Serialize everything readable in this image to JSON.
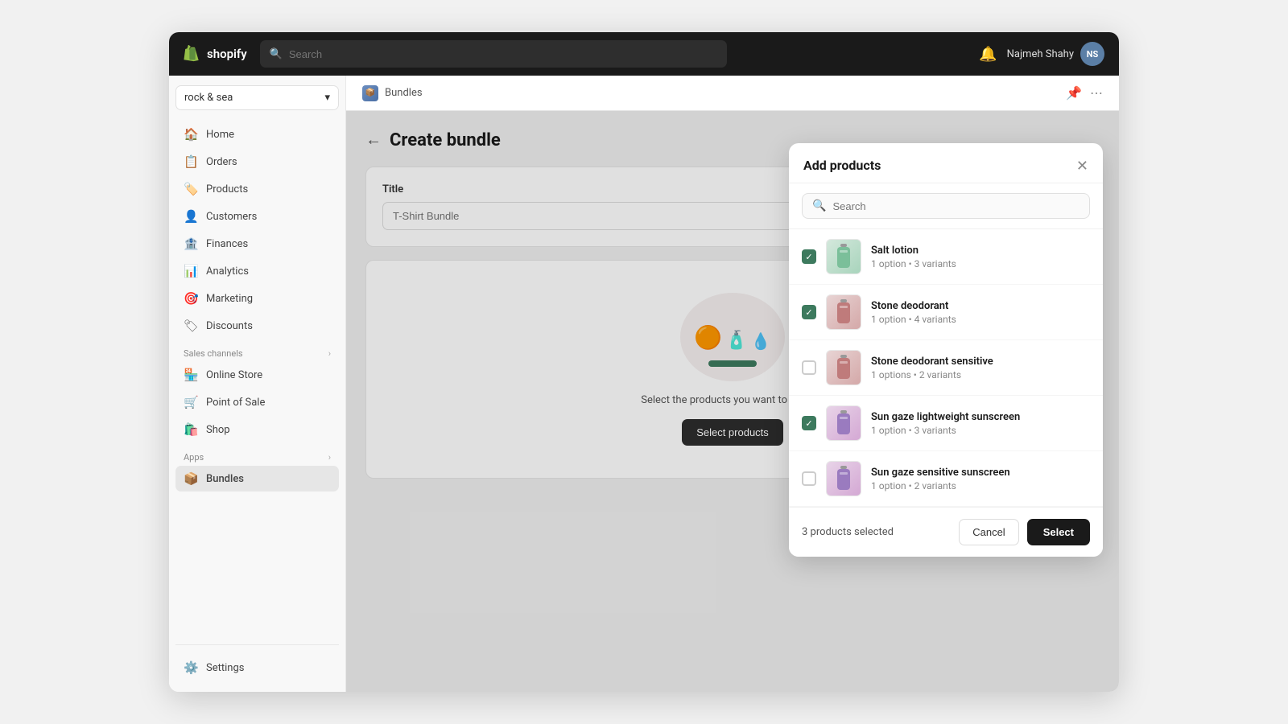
{
  "topbar": {
    "logo_text": "shopify",
    "search_placeholder": "Search",
    "user_name": "Najmeh Shahy",
    "user_initials": "NS"
  },
  "sidebar": {
    "store_name": "rock & sea",
    "nav_items": [
      {
        "id": "home",
        "label": "Home",
        "icon": "🏠"
      },
      {
        "id": "orders",
        "label": "Orders",
        "icon": "📋"
      },
      {
        "id": "products",
        "label": "Products",
        "icon": "🏷️"
      },
      {
        "id": "customers",
        "label": "Customers",
        "icon": "👤"
      },
      {
        "id": "finances",
        "label": "Finances",
        "icon": "🏦"
      },
      {
        "id": "analytics",
        "label": "Analytics",
        "icon": "📊"
      },
      {
        "id": "marketing",
        "label": "Marketing",
        "icon": "🎯"
      },
      {
        "id": "discounts",
        "label": "Discounts",
        "icon": "🏷"
      }
    ],
    "sales_channels_label": "Sales channels",
    "sales_channels": [
      {
        "id": "online-store",
        "label": "Online Store",
        "icon": "🏪"
      },
      {
        "id": "point-of-sale",
        "label": "Point of Sale",
        "icon": "🛒"
      },
      {
        "id": "shop",
        "label": "Shop",
        "icon": "🛍️"
      }
    ],
    "apps_label": "Apps",
    "apps": [
      {
        "id": "bundles",
        "label": "Bundles",
        "icon": "📦",
        "active": true
      }
    ],
    "settings_label": "Settings"
  },
  "content": {
    "app_name": "Bundles",
    "page_title": "Create bundle",
    "title_field_label": "Title",
    "title_placeholder": "T-Shirt Bundle",
    "bundle_desc": "Select the products you want to bundle.",
    "select_btn_label": "Select products"
  },
  "modal": {
    "title": "Add products",
    "search_placeholder": "Search",
    "products": [
      {
        "id": "salt-lotion",
        "name": "Salt lotion",
        "meta": "1 option • 3 variants",
        "checked": true,
        "thumb_type": "salt",
        "thumb_emoji": "🧴"
      },
      {
        "id": "stone-deodorant",
        "name": "Stone deodorant",
        "meta": "1 option • 4 variants",
        "checked": true,
        "thumb_type": "deo",
        "thumb_emoji": "🧴"
      },
      {
        "id": "stone-deodorant-sensitive",
        "name": "Stone deodorant sensitive",
        "meta": "1 options • 2 variants",
        "checked": false,
        "thumb_type": "deo",
        "thumb_emoji": "🧴"
      },
      {
        "id": "sun-gaze-lightweight",
        "name": "Sun gaze lightweight sunscreen",
        "meta": "1 option • 3 variants",
        "checked": true,
        "thumb_type": "sun",
        "thumb_emoji": "🧴"
      },
      {
        "id": "sun-gaze-sensitive",
        "name": "Sun gaze sensitive sunscreen",
        "meta": "1 option • 2 variants",
        "checked": false,
        "thumb_type": "sun",
        "thumb_emoji": "🧴"
      }
    ],
    "selected_count_text": "3 products selected",
    "cancel_label": "Cancel",
    "select_label": "Select"
  }
}
